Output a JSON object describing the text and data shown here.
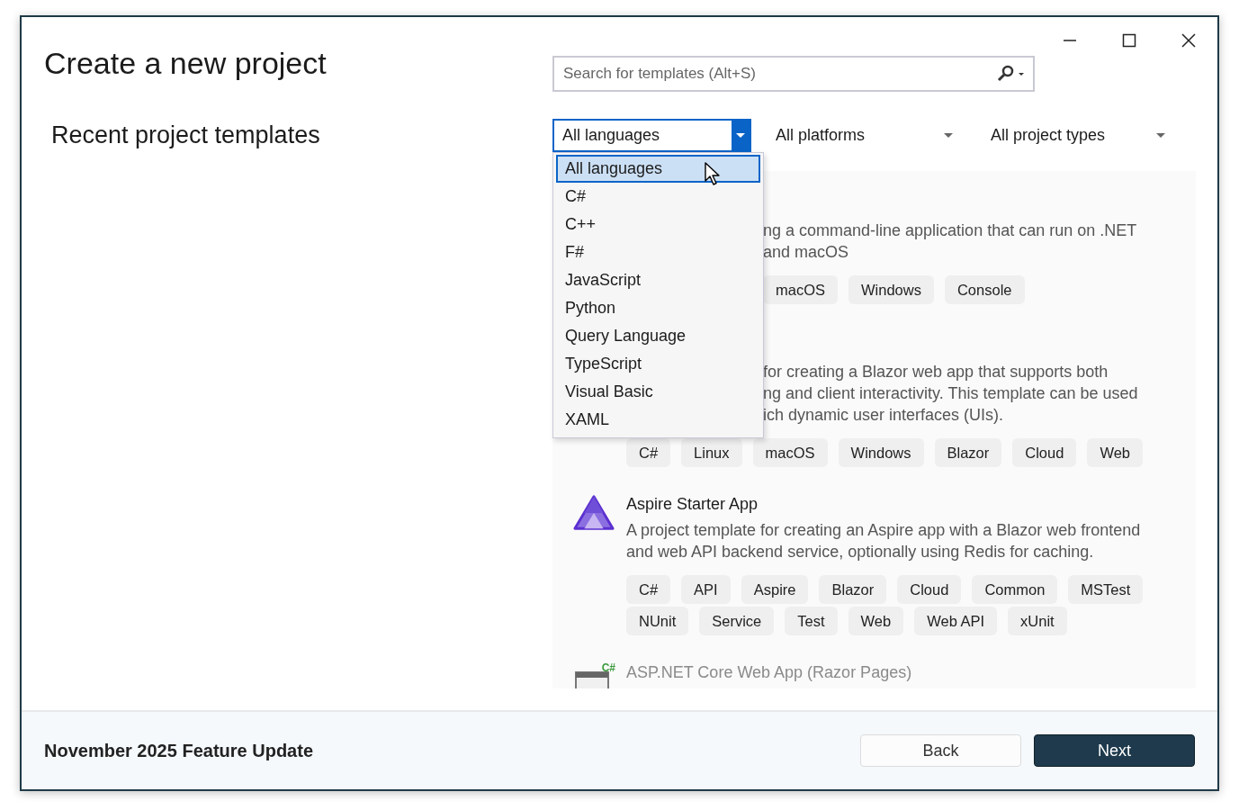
{
  "window": {
    "title": "Create a new project"
  },
  "search": {
    "placeholder": "Search for templates (Alt+S)"
  },
  "recent_heading": "Recent project templates",
  "filters": [
    {
      "label": "All languages",
      "open": true
    },
    {
      "label": "All platforms",
      "open": false
    },
    {
      "label": "All project types",
      "open": false
    }
  ],
  "language_menu": {
    "items": [
      {
        "label": "All languages",
        "selected": true
      },
      {
        "label": "C#",
        "selected": false
      },
      {
        "label": "C++",
        "selected": false
      },
      {
        "label": "F#",
        "selected": false
      },
      {
        "label": "JavaScript",
        "selected": false
      },
      {
        "label": "Python",
        "selected": false
      },
      {
        "label": "Query Language",
        "selected": false
      },
      {
        "label": "TypeScript",
        "selected": false
      },
      {
        "label": "Visual Basic",
        "selected": false
      },
      {
        "label": "XAML",
        "selected": false
      }
    ]
  },
  "templates": [
    {
      "kind": "partial",
      "description_lines": [
        "ng a command-line application that can run on .NET",
        "and macOS"
      ],
      "tags": [
        "macOS",
        "Windows",
        "Console"
      ]
    },
    {
      "kind": "partial_text",
      "description_lines": [
        "for creating a Blazor web app that supports both",
        "ng and client interactivity. This template can be used",
        "ich dynamic user interfaces (UIs)."
      ],
      "tags": [
        "C#",
        "Linux",
        "macOS",
        "Windows",
        "Blazor",
        "Cloud",
        "Web"
      ]
    },
    {
      "kind": "full",
      "title": "Aspire Starter App",
      "description_lines": [
        "A project template for creating an Aspire app with a Blazor web frontend",
        "and web API backend service, optionally using Redis for caching."
      ],
      "tags": [
        "C#",
        "API",
        "Aspire",
        "Blazor",
        "Cloud",
        "Common",
        "MSTest",
        "NUnit",
        "Service",
        "Test",
        "Web",
        "Web API",
        "xUnit"
      ]
    },
    {
      "kind": "cut",
      "icon_badge": "C#",
      "title": "ASP.NET Core Web App (Razor Pages)"
    }
  ],
  "footer": {
    "version": "November 2025 Feature Update",
    "buttons": [
      {
        "label": "Back",
        "kind": "secondary"
      },
      {
        "label": "Next",
        "kind": "primary"
      }
    ]
  }
}
